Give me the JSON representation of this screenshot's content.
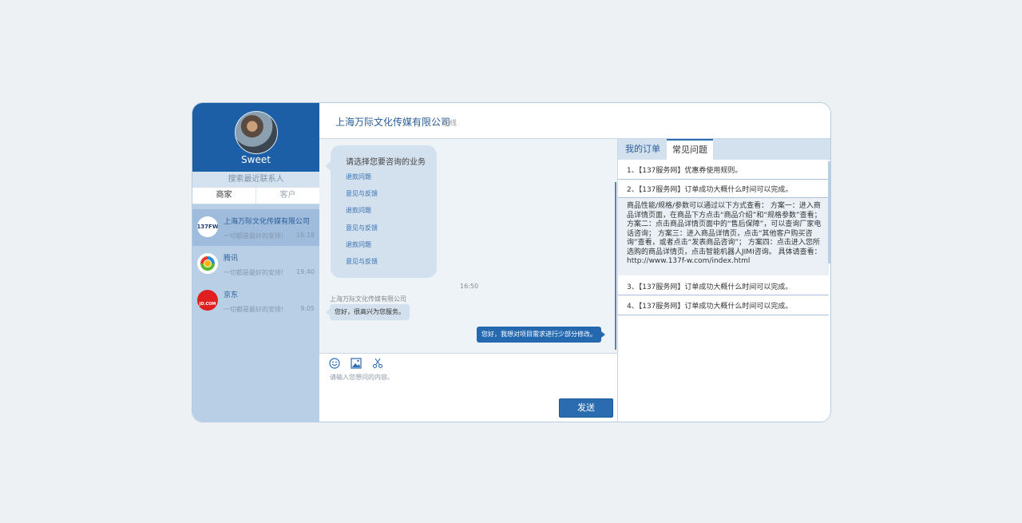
{
  "profile": {
    "username": "Sweet"
  },
  "sidebar": {
    "search_label": "搜索最近联系人",
    "tabs": [
      {
        "label": "商家"
      },
      {
        "label": "客户"
      }
    ],
    "contacts": [
      {
        "name": "上海万际文化传媒有限公司",
        "message": "一切都是最好的安排!",
        "time": "16:18",
        "logo": "137FW"
      },
      {
        "name": "腾讯",
        "message": "一切都是最好的安排!",
        "time": "19.40",
        "logo": "tencent"
      },
      {
        "name": "京东",
        "message": "一切都是最好的安排!",
        "time": "9.05",
        "logo": "JD.COM"
      }
    ]
  },
  "header": {
    "company": "上海万际文化传媒有限公司",
    "status": "在线"
  },
  "chat": {
    "menu_title": "请选择您要咨询的业务",
    "menu_items": [
      "退款问题",
      "意见与反馈",
      "退款问题",
      "意见与反馈",
      "退款问题",
      "意见与反馈"
    ],
    "timestamp": "16:50",
    "sender": "上海万际文化传媒有限公司",
    "incoming": "您好，很高兴为您服务。",
    "outgoing": "您好，我想对项目需求进行少部分修改。"
  },
  "input": {
    "placeholder": "请输入您想问的内容。",
    "send_label": "发送"
  },
  "right": {
    "tabs": [
      {
        "label": "我的订单"
      },
      {
        "label": "常见问题"
      }
    ],
    "faq": [
      "1、【137服务网】优惠券使用规则。",
      "2、【137服务网】订单成功大概什么时间可以完成。",
      "3、【137服务网】订单成功大概什么时间可以完成。",
      "4、【137服务网】订单成功大概什么时间可以完成。"
    ],
    "answer": "商品性能/规格/参数可以通过以下方式查看： 方案一：进入商品详情页面，在商品下方点击“商品介绍”和“规格参数”查看； 方案二：点击商品详情页面中的“售后保障”，可以查询厂家电话咨询； 方案三：进入商品详情页，点击“其他客户购买咨询”查看，或者点击“发表商品咨询”； 方案四：点击进入您所选购的商品详情页，点击智能机器人JIMI咨询。 具体请查看：http://www.137f-w.com/index.html"
  },
  "colors": {
    "primary": "#1d5fa6",
    "sidebar": "#b9cfe6",
    "accent": "#2b6cb0"
  }
}
